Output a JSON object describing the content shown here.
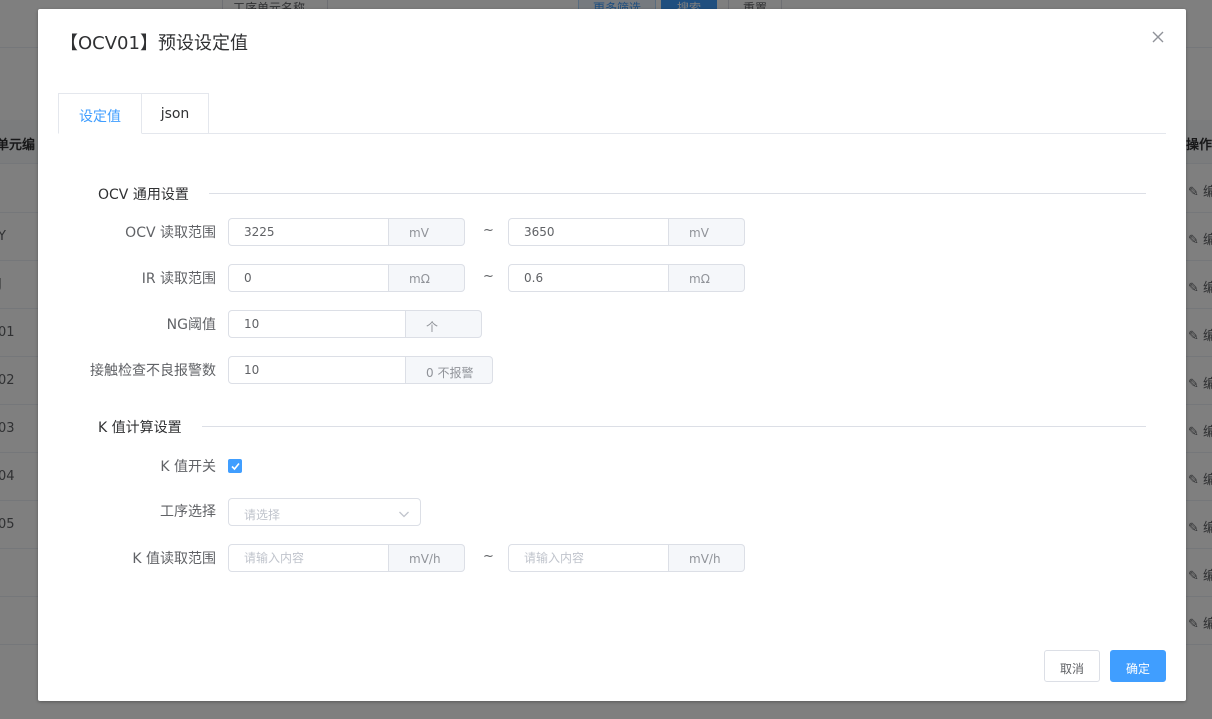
{
  "background": {
    "search_input_label": "工序单元名称",
    "more_filter_label": "更多筛选",
    "search_label": "搜索",
    "reset_label": "重置",
    "table_header": {
      "code": "单元编",
      "action": "操作"
    },
    "row_codes": [
      "",
      "Y",
      "J",
      "01",
      "02",
      "03",
      "04",
      "05",
      "",
      ""
    ],
    "row_action_label": "✎ 编"
  },
  "dialog": {
    "title": "【OCV01】预设设定值",
    "tabs": [
      {
        "label": "设定值",
        "active": true
      },
      {
        "label": "json",
        "active": false
      }
    ],
    "sections": {
      "ocv": {
        "title": "OCV 通用设置"
      },
      "k": {
        "title": "K 值计算设置"
      }
    },
    "fields": {
      "ocv_range": {
        "label": "OCV 读取范围",
        "min": "3225",
        "max": "3650",
        "unit": "mV"
      },
      "ir_range": {
        "label": "IR 读取范围",
        "min": "0",
        "max": "0.6",
        "unit": "mΩ"
      },
      "ng_threshold": {
        "label": "NG阈值",
        "value": "10",
        "unit": "个"
      },
      "contact_alarm": {
        "label": "接触检查不良报警数",
        "value": "10",
        "unit": "0 不报警"
      },
      "k_switch": {
        "label": "K 值开关",
        "checked": true
      },
      "process_select": {
        "label": "工序选择",
        "placeholder": "请选择"
      },
      "k_range": {
        "label": "K 值读取范围",
        "min_placeholder": "请输入内容",
        "max_placeholder": "请输入内容",
        "unit": "mV/h"
      }
    },
    "range_separator": "~",
    "footer": {
      "cancel_label": "取消",
      "ok_label": "确定"
    }
  },
  "colors": {
    "primary": "#409eff",
    "border": "#dcdfe6",
    "mask": "rgba(0,0,0,0.5)"
  }
}
